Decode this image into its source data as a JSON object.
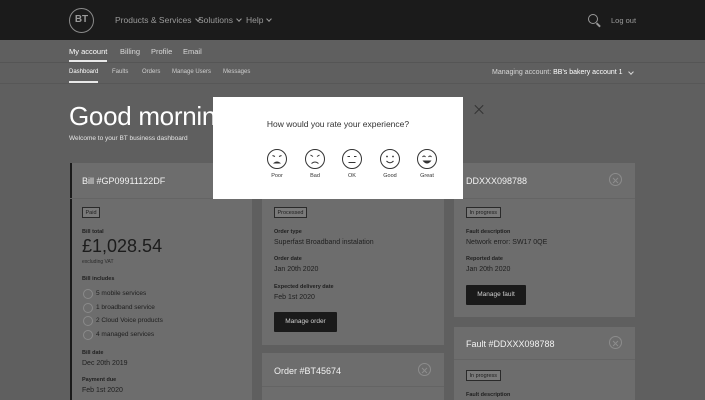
{
  "header": {
    "logo": "BT",
    "nav": [
      "Products & Services",
      "Solutions",
      "Help"
    ],
    "logout": "Log out"
  },
  "account_nav": [
    "My account",
    "Billing",
    "Profile",
    "Email"
  ],
  "sub_nav": [
    "Dashboard",
    "Faults",
    "Orders",
    "Manage Users",
    "Messages"
  ],
  "managing": {
    "label": "Managing account:",
    "account": "BB's bakery account 1"
  },
  "greeting": {
    "title": "Good morning S",
    "welcome": "Welcome to your BT business dashboard"
  },
  "bill_card": {
    "title": "Bill #GP09911122DF",
    "status": "Paid",
    "total_label": "Bill total",
    "total": "£1,028.54",
    "vat": "excluding VAT",
    "includes_label": "Bill includes",
    "includes": [
      "5 mobile services",
      "1 broadband service",
      "2 Cloud Voice products",
      "4 managed services"
    ],
    "date_label": "Bill date",
    "date": "Dec 20th 2019",
    "due_label": "Payment due",
    "due": "Feb 1st 2020"
  },
  "order_card": {
    "status": "Processed",
    "type_label": "Order type",
    "type": "Superfast Broadband instalation",
    "date_label": "Order date",
    "date": "Jan 20th 2020",
    "delivery_label": "Expected delivery date",
    "delivery": "Feb 1st 2020",
    "button": "Manage order"
  },
  "order_card_2": {
    "title": "Order #BT45674"
  },
  "fault_card": {
    "title": "DDXXX098788",
    "status": "In progress",
    "desc_label": "Fault description",
    "desc": "Network error: SW17 0QE",
    "date_label": "Reported date",
    "date": "Jan 20th 2020",
    "button": "Manage fault"
  },
  "fault_card_2": {
    "title": "Fault #DDXXX098788",
    "status": "In progress",
    "desc_label": "Fault description"
  },
  "modal": {
    "question": "How would you rate your experience?",
    "options": [
      "Poor",
      "Bad",
      "OK",
      "Good",
      "Great"
    ]
  }
}
